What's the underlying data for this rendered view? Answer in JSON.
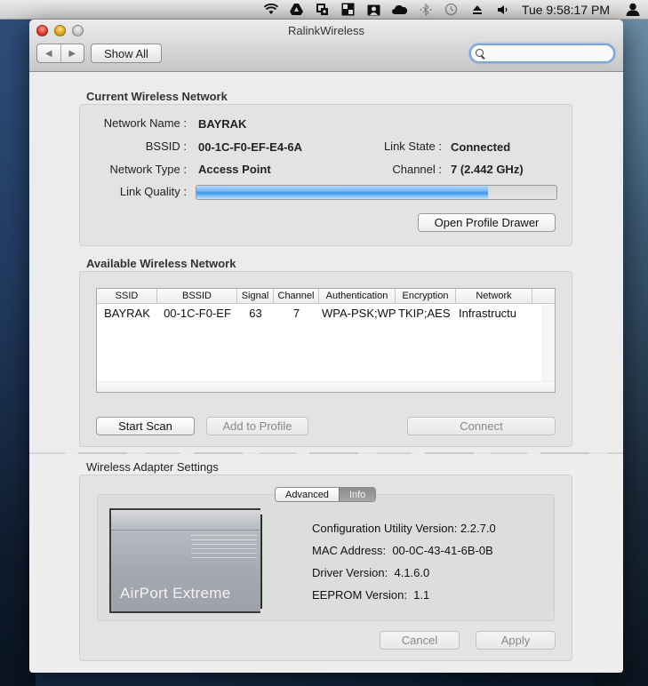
{
  "menubar": {
    "icons": [
      "wifi-icon",
      "google-drive-icon",
      "screen-share-icon",
      "display-switch-icon",
      "profile-card-icon",
      "cloud-icon",
      "bluetooth-icon",
      "time-machine-icon",
      "eject-icon",
      "volume-icon"
    ],
    "clock": "Tue 9:58:17 PM",
    "user_icon": "user-icon"
  },
  "window": {
    "title": "RalinkWireless",
    "show_all_label": "Show All",
    "search_placeholder": ""
  },
  "current_network": {
    "title": "Current Wireless Network",
    "network_name_label": "Network Name :",
    "network_name": "BAYRAK",
    "bssid_label": "BSSID :",
    "bssid": "00-1C-F0-EF-E4-6A",
    "link_state_label": "Link State :",
    "link_state": "Connected",
    "network_type_label": "Network Type :",
    "network_type": "Access Point",
    "channel_label": "Channel :",
    "channel": "7 (2.442 GHz)",
    "link_quality_label": "Link Quality :",
    "link_quality_percent": 81,
    "open_profile_drawer_label": "Open Profile Drawer"
  },
  "available_networks": {
    "title": "Available Wireless Network",
    "columns": [
      "SSID",
      "BSSID",
      "Signal",
      "Channel",
      "Authentication",
      "Encryption",
      "Network"
    ],
    "rows": [
      [
        "BAYRAK",
        "00-1C-F0-EF",
        "63",
        "7",
        "WPA-PSK;WP/",
        "TKIP;AES",
        "Infrastructu"
      ]
    ],
    "start_scan_label": "Start Scan",
    "add_to_profile_label": "Add to Profile",
    "connect_label": "Connect"
  },
  "adapter_settings": {
    "title": "Wireless Adapter Settings",
    "tabs": [
      {
        "label": "Advanced",
        "active": false
      },
      {
        "label": "Info",
        "active": true
      }
    ],
    "card_label": "AirPort Extreme",
    "info": [
      {
        "label": "Configuration Utility Version:",
        "value": "2.2.7.0"
      },
      {
        "label": "MAC Address:",
        "value": "00-0C-43-41-6B-0B"
      },
      {
        "label": "Driver Version:",
        "value": "4.1.6.0"
      },
      {
        "label": "EEPROM Version:",
        "value": "1.1"
      }
    ],
    "cancel_label": "Cancel",
    "apply_label": "Apply"
  }
}
